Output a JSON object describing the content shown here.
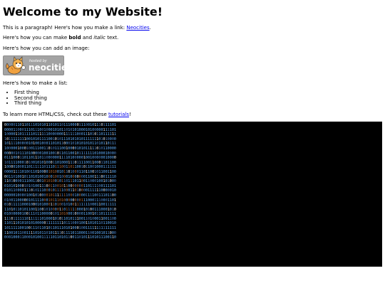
{
  "heading": "Welcome to my Website!",
  "para1": {
    "before": "This is a paragraph! Here's how you make a link: ",
    "link": "Neocities",
    "after": "."
  },
  "para2": {
    "before": "Here's how you can make ",
    "bold": "bold",
    "middle": " and ",
    "italic": "italic",
    "after": " text."
  },
  "para3": "Here's how you can add an image:",
  "badge": {
    "line1": "hosted by",
    "line2": "neocities",
    "bg_color": "#a3a3a3"
  },
  "para4": "Here's how to make a list:",
  "list": [
    "First thing",
    "Second thing",
    "Third thing"
  ],
  "para5": {
    "before": "To learn more HTML/CSS, check out these ",
    "link": "tutorials",
    "after": "!"
  },
  "binary_rows": [
    "000001101101110101011010110111000011100101110111101",
    "000011000111011100100010101101010100010100000111101",
    "100001101111101111110000000111111000111010110111111",
    "101111111100101011110010101110101010111111101010000",
    "101111000001010010001101011000101010101011010110111",
    "100000100010011100110101110010000101011111010110000",
    "000001011101000001001001011011001011111110100010000",
    "011100011011011101100000011110100000100100000010000",
    "101111000101001010100011010001110111100110001101100",
    "100001000110111111011101110011011001011001000111111",
    "000011110100110100001010010110100011011001011001100",
    "001101001011010100100010010001000000011001110011110",
    "110100001110011001010100101101110110011000100101000",
    "010101000101010011100110010110000000110111100111101",
    "010110000111010111000101111000110100001111110000010",
    "000001000010010100001011111110001000011110011101100",
    "010011000001011110001011101000000001110001110001101",
    "010111110001000101000110100101001111111000110011111",
    "110101101011001100101000011011111000101001110001010",
    "010000001001110110000010110100010000110010110111111",
    "111011111101111110100010101101011100110100011001100",
    "110111010101010000011111111011100010011010110110010",
    "101111100100111011010110111010100010011111111111111",
    "110010110011110101101011110111101100011001001011000",
    "000100011000101001111101101011001101011101011100110"
  ]
}
